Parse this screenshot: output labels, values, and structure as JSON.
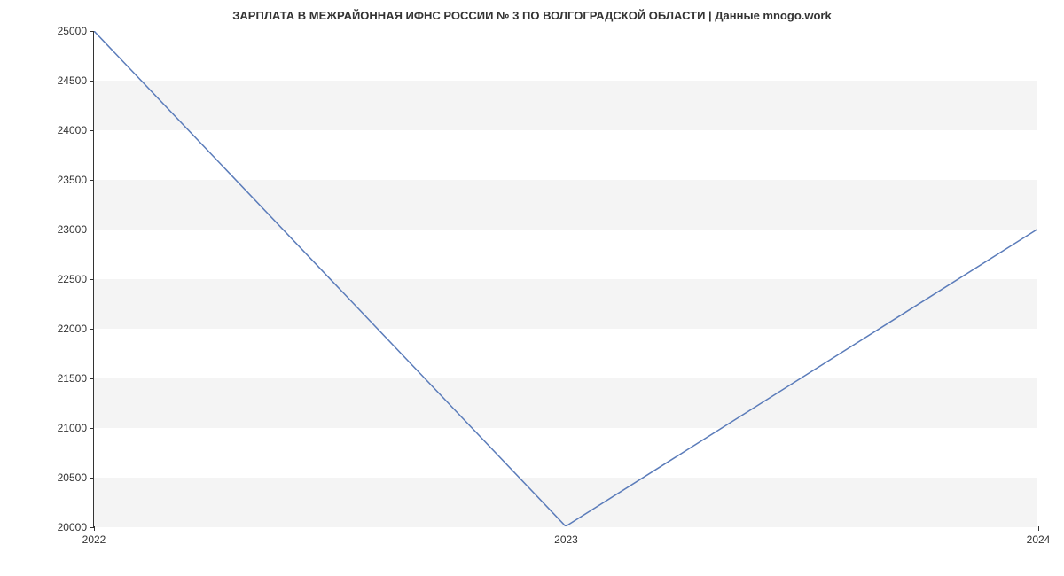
{
  "chart_data": {
    "type": "line",
    "title": "ЗАРПЛАТА В МЕЖРАЙОННАЯ ИФНС РОССИИ № 3 ПО ВОЛГОГРАДСКОЙ ОБЛАСТИ | Данные mnogo.work",
    "xlabel": "",
    "ylabel": "",
    "x": [
      "2022",
      "2023",
      "2024"
    ],
    "y": [
      25000,
      20000,
      23000
    ],
    "x_ticks": [
      "2022",
      "2023",
      "2024"
    ],
    "y_ticks": [
      20000,
      20500,
      21000,
      21500,
      22000,
      22500,
      23000,
      23500,
      24000,
      24500,
      25000
    ],
    "ylim": [
      20000,
      25000
    ],
    "xlim": [
      2022,
      2024
    ],
    "line_color": "#5b7cba",
    "grid_bands": true
  }
}
